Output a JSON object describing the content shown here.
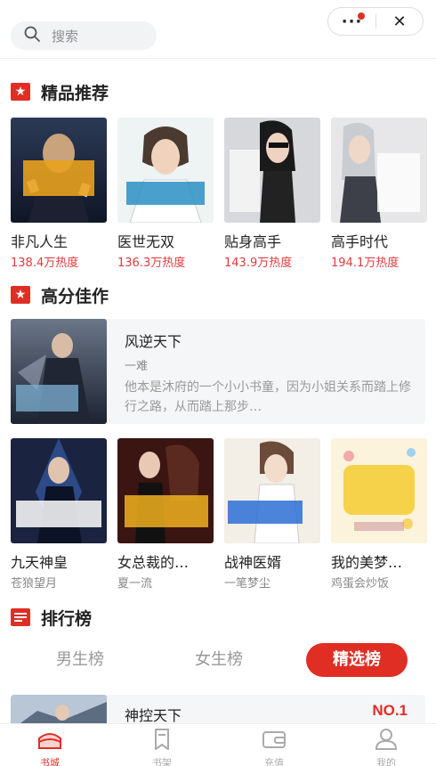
{
  "search": {
    "placeholder": "搜索"
  },
  "capsule": {
    "more_label": "···",
    "close_label": "✕"
  },
  "colors": {
    "accent": "#e02e24",
    "heat": "#e4393c",
    "muted": "#999999"
  },
  "sections": {
    "featured": {
      "title": "精品推荐",
      "icon": "star-icon"
    },
    "high_score": {
      "title": "高分佳作",
      "icon": "star-icon"
    },
    "ranking": {
      "title": "排行榜",
      "icon": "list-icon"
    }
  },
  "featured_books": [
    {
      "title": "非凡人生",
      "heat": "138.4万热度"
    },
    {
      "title": "医世无双",
      "heat": "136.3万热度"
    },
    {
      "title": "贴身高手",
      "heat": "143.9万热度"
    },
    {
      "title": "高手时代",
      "heat": "194.1万热度"
    }
  ],
  "highlight_book": {
    "title": "风逆天下",
    "author": "一难",
    "description": "他本是沐府的一个小小书童，因为小姐关系而踏上修行之路，从而踏上那步…"
  },
  "high_score_books": [
    {
      "title": "九天神皇",
      "author": "苍狼望月"
    },
    {
      "title": "女总裁的…",
      "author": "夏一流"
    },
    {
      "title": "战神医婿",
      "author": "一笔梦尘"
    },
    {
      "title": "我的美梦…",
      "author": "鸡蛋会炒饭"
    }
  ],
  "ranking_tabs": [
    {
      "label": "男生榜",
      "active": false
    },
    {
      "label": "女生榜",
      "active": false
    },
    {
      "label": "精选榜",
      "active": true
    }
  ],
  "rank_item": {
    "title": "神控天下",
    "rank": "NO.1"
  },
  "nav": [
    {
      "label": "书城",
      "icon": "bookstore-icon",
      "active": true
    },
    {
      "label": "书架",
      "icon": "bookmark-icon",
      "active": false
    },
    {
      "label": "充值",
      "icon": "wallet-icon",
      "active": false
    },
    {
      "label": "我的",
      "icon": "user-icon",
      "active": false
    }
  ]
}
